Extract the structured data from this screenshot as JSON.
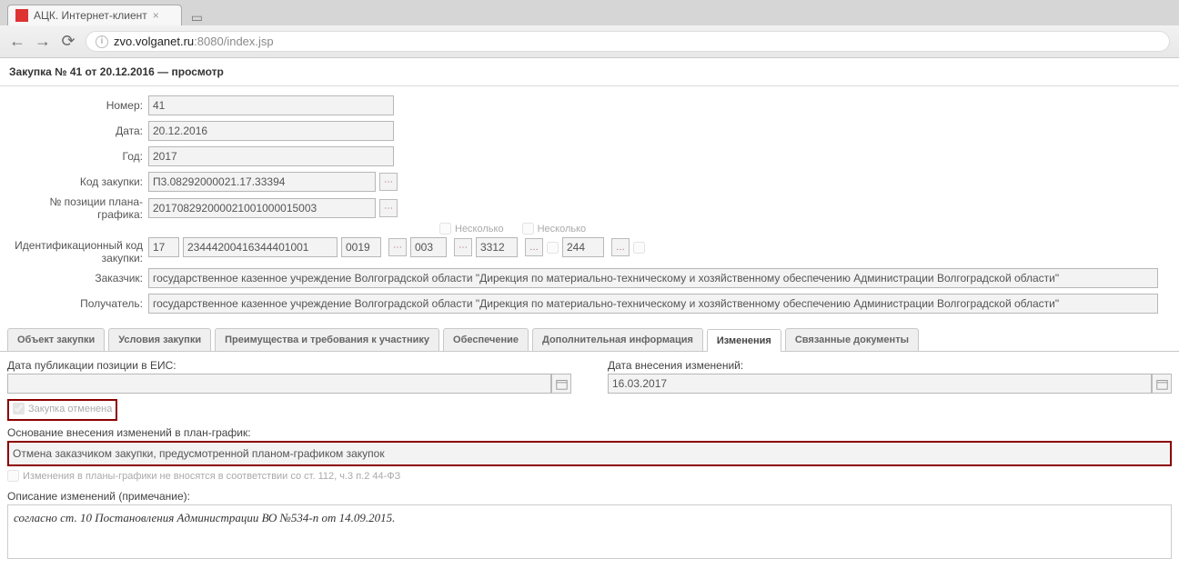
{
  "browser": {
    "tab_title": "АЦК. Интернет-клиент",
    "url_host": "zvo.volganet.ru",
    "url_port": ":8080",
    "url_path": "/index.jsp"
  },
  "page_title": "Закупка № 41 от 20.12.2016 — просмотр",
  "form": {
    "number_label": "Номер:",
    "number_value": "41",
    "date_label": "Дата:",
    "date_value": "20.12.2016",
    "year_label": "Год:",
    "year_value": "2017",
    "code_label": "Код закупки:",
    "code_value": "П3.08292000021.17.33394",
    "planpos_label": "№ позиции плана-графика:",
    "planpos_value": "201708292000021001000015003",
    "ident_label": "Идентификационный код закупки:",
    "ident_parts": {
      "p1": "17",
      "p2": "23444200416344401001",
      "p3": "0019",
      "p4": "003",
      "p5": "3312",
      "p6": "244"
    },
    "several1": "Несколько",
    "several2": "Несколько",
    "customer_label": "Заказчик:",
    "customer_value": "государственное казенное учреждение Волгоградской области \"Дирекция по материально-техническому и хозяйственному обеспечению Администрации Волгоградской области\"",
    "receiver_label": "Получатель:",
    "receiver_value": "государственное казенное учреждение Волгоградской области \"Дирекция по материально-техническому и хозяйственному обеспечению Администрации Волгоградской области\""
  },
  "tabs": {
    "t1": "Объект закупки",
    "t2": "Условия закупки",
    "t3": "Преимущества и требования к участнику",
    "t4": "Обеспечение",
    "t5": "Дополнительная информация",
    "t6": "Изменения",
    "t7": "Связанные документы"
  },
  "changes": {
    "pub_label": "Дата публикации позиции в ЕИС:",
    "pub_value": "",
    "chg_label": "Дата внесения изменений:",
    "chg_value": "16.03.2017",
    "cancelled_label": "Закупка отменена",
    "basis_label": "Основание внесения изменений в план-график:",
    "basis_value": "Отмена заказчиком закупки, предусмотренной планом-графиком закупок",
    "noplan_label": "Изменения в планы-графики не вносятся в соответствии со ст. 112, ч.3 п.2 44-ФЗ",
    "desc_label": "Описание изменений (примечание):",
    "desc_value": "согласно ст. 10 Постановления Администрации ВО №534-п от 14.09.2015."
  }
}
